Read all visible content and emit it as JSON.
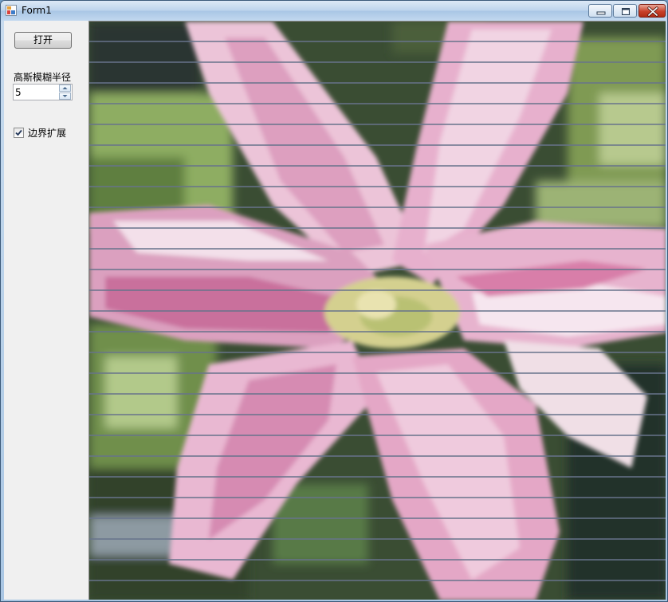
{
  "window": {
    "title": "Form1",
    "minimize_label": "minimize",
    "maximize_label": "maximize",
    "close_label": "close"
  },
  "controls": {
    "open_button_label": "打开",
    "radius_label": "高斯模糊半径",
    "radius_value": "5",
    "expand_label": "边界扩展",
    "expand_checked": true
  },
  "image": {
    "subject": "pink lily flower with green foliage background, horizontal line artifacts",
    "palette": {
      "petal_pink": "#e3a7c4",
      "petal_light": "#f2e3ee",
      "petal_deep": "#c9628f",
      "center_green": "#c8d08a",
      "foliage_light": "#a9c27a",
      "foliage_dark": "#34482e",
      "line_color": "#6f7a8a"
    }
  },
  "icons": {
    "app_icon": "form-app-icon",
    "spin_up": "chevron-up-icon",
    "spin_down": "chevron-down-icon",
    "check": "checkmark-icon"
  }
}
